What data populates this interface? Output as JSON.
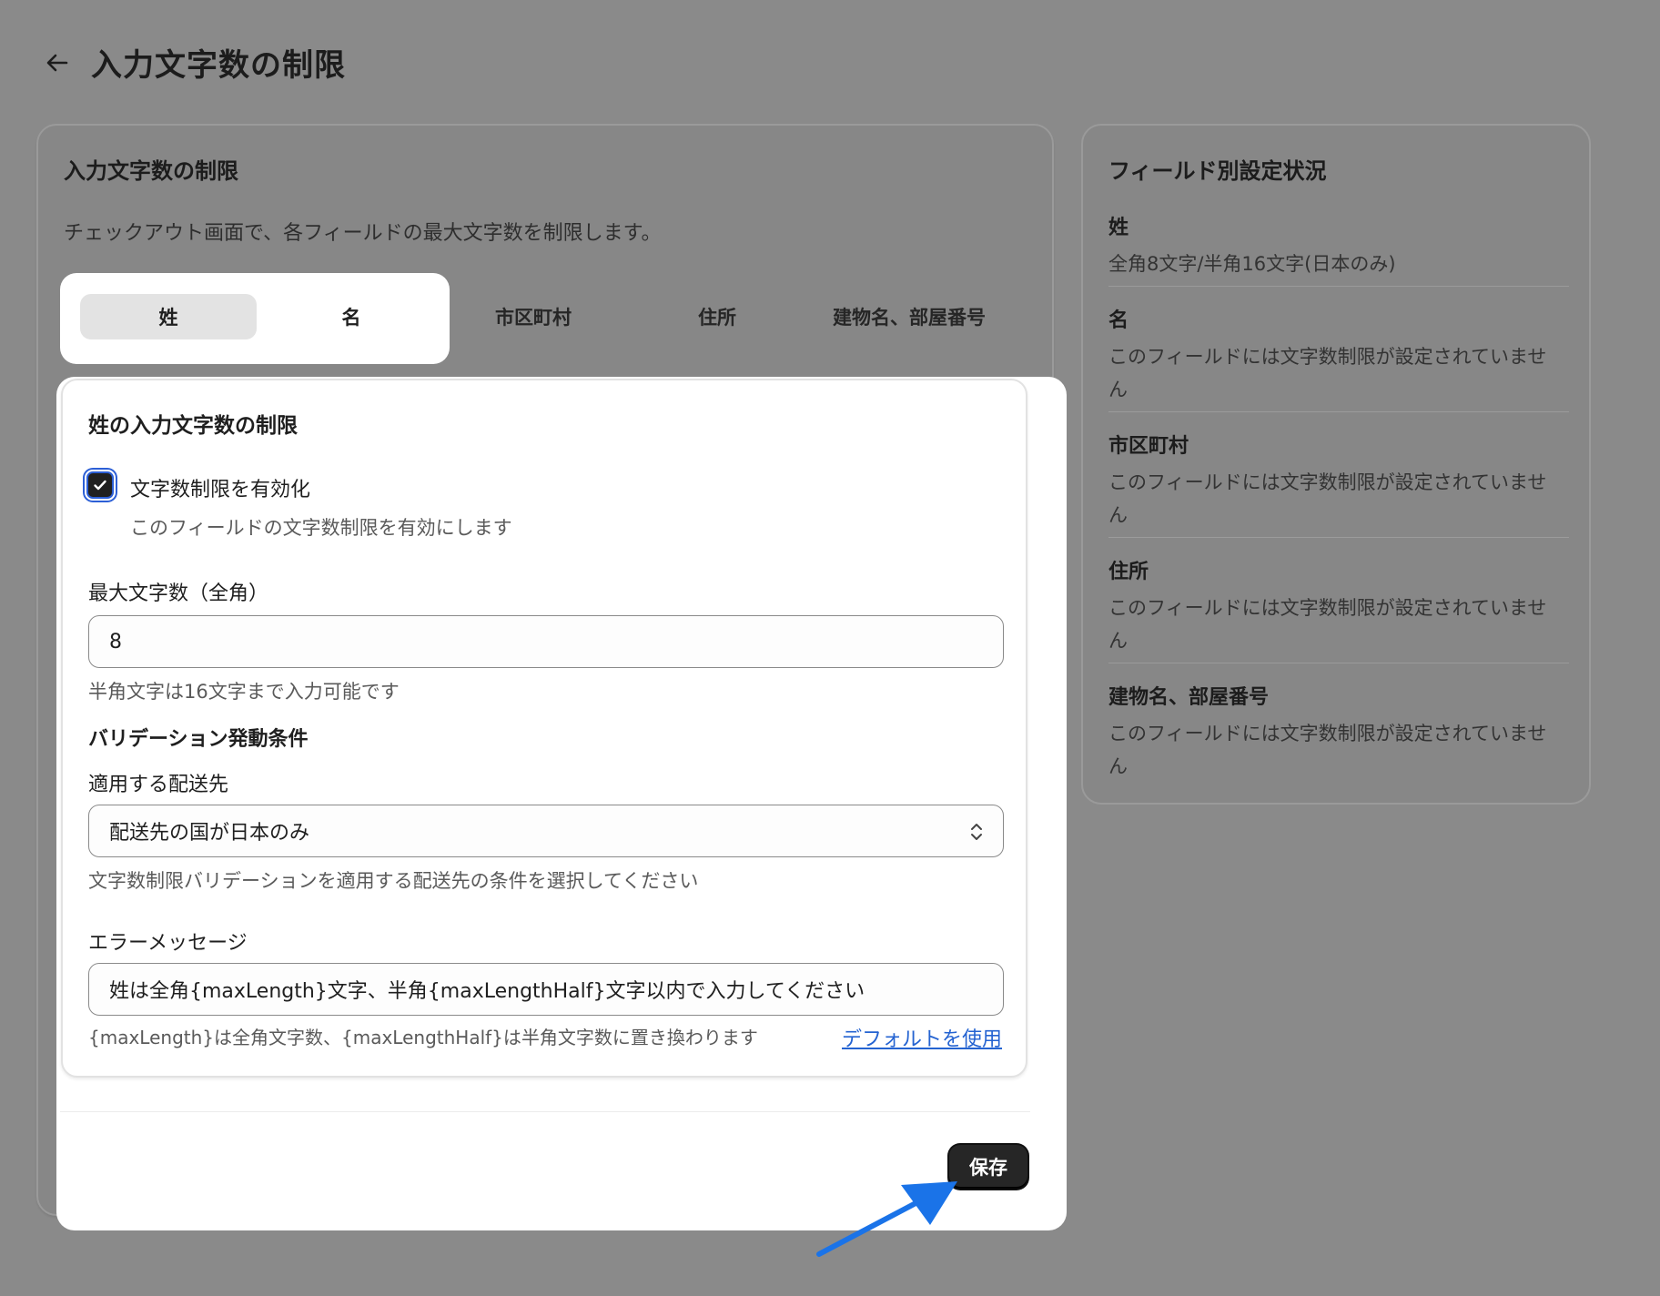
{
  "header": {
    "title": "入力文字数の制限"
  },
  "left_card": {
    "title": "入力文字数の制限",
    "description": "チェックアウト画面で、各フィールドの最大文字数を制限します。",
    "tabs": [
      {
        "label": "姓",
        "active": true
      },
      {
        "label": "名",
        "active": false
      },
      {
        "label": "市区町村",
        "active": false
      },
      {
        "label": "住所",
        "active": false
      },
      {
        "label": "建物名、部屋番号",
        "active": false
      }
    ]
  },
  "form": {
    "title": "姓の入力文字数の制限",
    "enable_checkbox": {
      "label": "文字数制限を有効化",
      "help": "このフィールドの文字数制限を有効にします",
      "checked": true
    },
    "max_length": {
      "label": "最大文字数（全角）",
      "value": "8",
      "help": "半角文字は16文字まで入力可能です"
    },
    "validation_section_title": "バリデーション発動条件",
    "destination": {
      "label": "適用する配送先",
      "value": "配送先の国が日本のみ",
      "help": "文字数制限バリデーションを適用する配送先の条件を選択してください"
    },
    "error_message": {
      "label": "エラーメッセージ",
      "value": "姓は全角{maxLength}文字、半角{maxLengthHalf}文字以内で入力してください",
      "help": "{maxLength}は全角文字数、{maxLengthHalf}は半角文字数に置き換わります",
      "default_link": "デフォルトを使用"
    },
    "save_label": "保存"
  },
  "status_card": {
    "title": "フィールド別設定状況",
    "items": [
      {
        "name": "姓",
        "value": "全角8文字/半角16文字(日本のみ)"
      },
      {
        "name": "名",
        "value": "このフィールドには文字数制限が設定されていません"
      },
      {
        "name": "市区町村",
        "value": "このフィールドには文字数制限が設定されていません"
      },
      {
        "name": "住所",
        "value": "このフィールドには文字数制限が設定されていません"
      },
      {
        "name": "建物名、部屋番号",
        "value": "このフィールドには文字数制限が設定されていません"
      }
    ]
  },
  "colors": {
    "overlay": "#8a8a8a",
    "primary_button": "#262626",
    "link": "#2463d1",
    "annotation_arrow": "#1a73e8"
  },
  "icons": {
    "back": "arrow-left-icon",
    "checkbox": "check-icon",
    "select": "chevron-up-down-icon",
    "annotation": "annotation-arrow-icon"
  }
}
